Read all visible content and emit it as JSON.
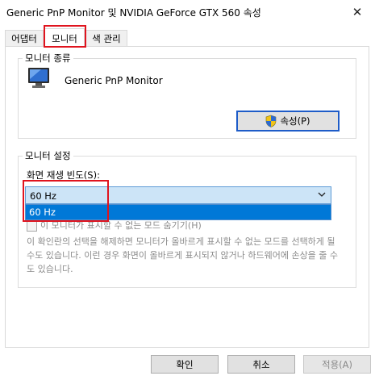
{
  "window": {
    "title": "Generic PnP Monitor 및 NVIDIA GeForce GTX 560 속성",
    "close_glyph": "✕"
  },
  "tabs": [
    {
      "label": "어댑터"
    },
    {
      "label": "모니터",
      "active": true
    },
    {
      "label": "색 관리"
    }
  ],
  "monitor_type": {
    "group_label": "모니터 종류",
    "monitor_name": "Generic PnP Monitor",
    "properties_button": "속성(P)"
  },
  "monitor_settings": {
    "group_label": "모니터 설정",
    "refresh_label": "화면 재생 빈도(S):",
    "refresh_selected": "60 Hz",
    "dropdown_options": [
      "60 Hz"
    ],
    "hide_modes_checkbox": "이 모니터가 표시할 수 없는 모드 숨기기(H)",
    "hide_modes_checked": false,
    "warning_text": "이 확인란의 선택을 해제하면 모니터가 올바르게 표시할 수 없는 모드를 선택하게 될 수도 있습니다. 이런 경우 화면이 올바르게 표시되지 않거나 하드웨어에 손상을 줄 수도 있습니다."
  },
  "footer": {
    "ok": "확인",
    "cancel": "취소",
    "apply": "적용(A)"
  },
  "colors": {
    "highlight_red": "#e0141e",
    "accent_blue": "#0078d7",
    "selected_bg": "#cce4f7"
  }
}
